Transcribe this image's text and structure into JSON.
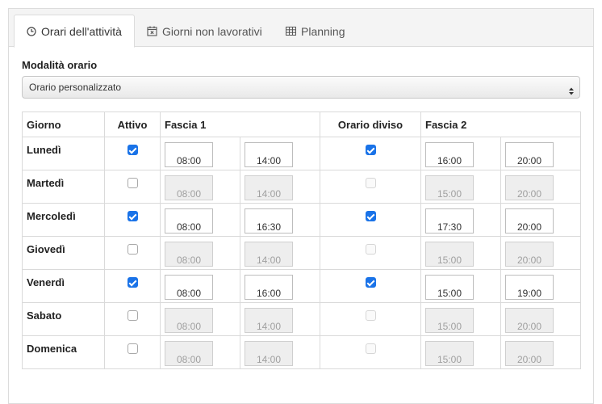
{
  "tabs": [
    {
      "label": "Orari dell'attività",
      "icon": "clock-icon",
      "active": true
    },
    {
      "label": "Giorni non lavorativi",
      "icon": "calendar-x-icon",
      "active": false
    },
    {
      "label": "Planning",
      "icon": "table-grid-icon",
      "active": false
    }
  ],
  "mode": {
    "label": "Modalità orario",
    "selected": "Orario personalizzato"
  },
  "table": {
    "headers": {
      "day": "Giorno",
      "active": "Attivo",
      "slot1": "Fascia 1",
      "split": "Orario diviso",
      "slot2": "Fascia 2"
    },
    "rows": [
      {
        "day": "Lunedì",
        "active": true,
        "s1_from": "08:00",
        "s1_to": "14:00",
        "split": true,
        "s2_from": "16:00",
        "s2_to": "20:00"
      },
      {
        "day": "Martedì",
        "active": false,
        "s1_from": "08:00",
        "s1_to": "14:00",
        "split": false,
        "s2_from": "15:00",
        "s2_to": "20:00"
      },
      {
        "day": "Mercoledì",
        "active": true,
        "s1_from": "08:00",
        "s1_to": "16:30",
        "split": true,
        "s2_from": "17:30",
        "s2_to": "20:00"
      },
      {
        "day": "Giovedì",
        "active": false,
        "s1_from": "08:00",
        "s1_to": "14:00",
        "split": false,
        "s2_from": "15:00",
        "s2_to": "20:00"
      },
      {
        "day": "Venerdì",
        "active": true,
        "s1_from": "08:00",
        "s1_to": "16:00",
        "split": true,
        "s2_from": "15:00",
        "s2_to": "19:00"
      },
      {
        "day": "Sabato",
        "active": false,
        "s1_from": "08:00",
        "s1_to": "14:00",
        "split": false,
        "s2_from": "15:00",
        "s2_to": "20:00"
      },
      {
        "day": "Domenica",
        "active": false,
        "s1_from": "08:00",
        "s1_to": "14:00",
        "split": false,
        "s2_from": "15:00",
        "s2_to": "20:00"
      }
    ]
  },
  "colors": {
    "accent": "#1a73e8",
    "border": "#dadada",
    "disabled_bg": "#eeeeee"
  }
}
